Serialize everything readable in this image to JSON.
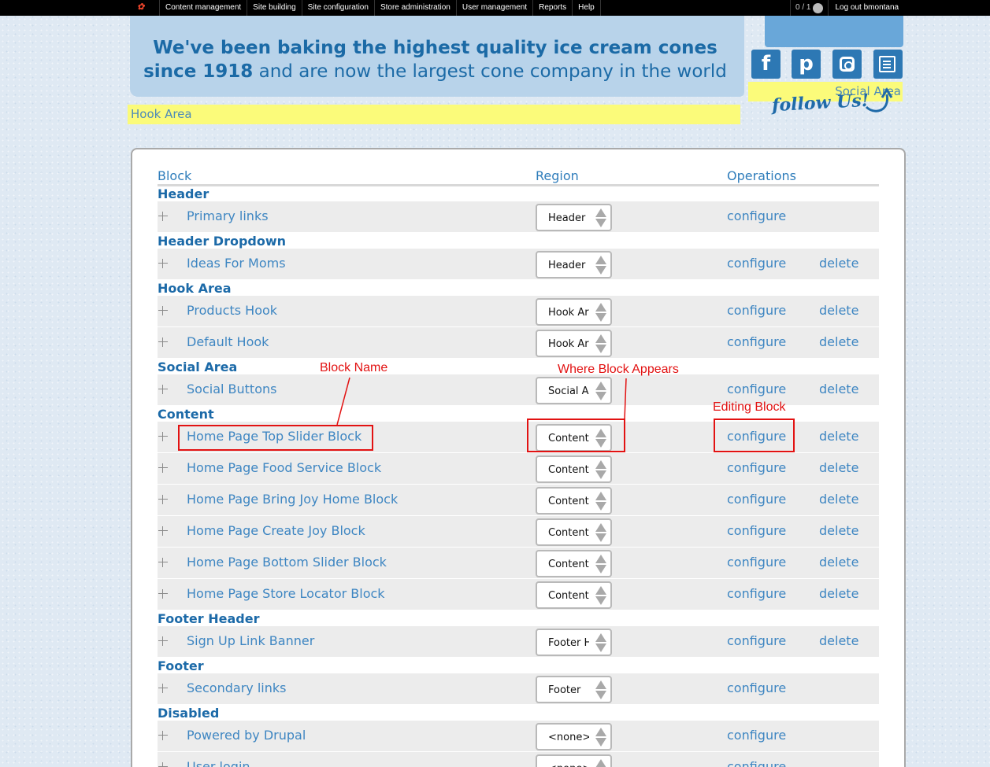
{
  "admin_bar": {
    "menu": [
      "Content management",
      "Site building",
      "Site configuration",
      "Store administration",
      "User management",
      "Reports",
      "Help"
    ],
    "counter": "0 / 1",
    "logout": "Log out bmontana"
  },
  "banner": {
    "line1": "We've been baking the highest quality ice cream cones",
    "line2_bold": "since 1918",
    "line2_rest": " and are now the largest cone company in the world"
  },
  "social": {
    "buttons": [
      {
        "icon": "facebook-icon",
        "glyph": "f"
      },
      {
        "icon": "pinterest-icon",
        "glyph": "p"
      },
      {
        "icon": "instagram-icon",
        "glyph": ""
      },
      {
        "icon": "edit-icon",
        "glyph": ""
      }
    ],
    "area_label": "Social Area",
    "follow_text": "follow Us!"
  },
  "hook_area_label": "Hook Area",
  "table": {
    "headers": {
      "block": "Block",
      "region": "Region",
      "operations": "Operations"
    },
    "configure_label": "configure",
    "delete_label": "delete",
    "groups": [
      {
        "region": "Header",
        "rows": [
          {
            "name": "Primary links",
            "region": "Header",
            "delete": false
          }
        ]
      },
      {
        "region": "Header Dropdown",
        "rows": [
          {
            "name": "Ideas For Moms",
            "region": "Header Dropdown",
            "delete": true
          }
        ]
      },
      {
        "region": "Hook Area",
        "rows": [
          {
            "name": "Products Hook",
            "region": "Hook Area",
            "delete": true
          },
          {
            "name": "Default Hook",
            "region": "Hook Area",
            "delete": true
          }
        ]
      },
      {
        "region": "Social Area",
        "rows": [
          {
            "name": "Social Buttons",
            "region": "Social Area",
            "delete": true
          }
        ]
      },
      {
        "region": "Content",
        "rows": [
          {
            "name": "Home Page Top Slider Block",
            "region": "Content",
            "delete": true
          },
          {
            "name": "Home Page Food Service Block",
            "region": "Content",
            "delete": true
          },
          {
            "name": "Home Page Bring Joy Home Block",
            "region": "Content",
            "delete": true
          },
          {
            "name": "Home Page Create Joy Block",
            "region": "Content",
            "delete": true
          },
          {
            "name": "Home Page Bottom Slider Block",
            "region": "Content",
            "delete": true
          },
          {
            "name": "Home Page Store Locator Block",
            "region": "Content",
            "delete": true
          }
        ]
      },
      {
        "region": "Footer Header",
        "rows": [
          {
            "name": "Sign Up Link Banner",
            "region": "Footer Header",
            "delete": true
          }
        ]
      },
      {
        "region": "Footer",
        "rows": [
          {
            "name": "Secondary links",
            "region": "Footer",
            "delete": false
          }
        ]
      },
      {
        "region": "Disabled",
        "rows": [
          {
            "name": "Powered by Drupal",
            "region": "<none>",
            "delete": false
          },
          {
            "name": "User login",
            "region": "<none>",
            "delete": false
          }
        ]
      }
    ]
  },
  "annotations": {
    "block_name": "Block Name",
    "where_block_appears": "Where Block Appears",
    "editing_block": "Editing Block",
    "color": "#e21212"
  },
  "colors": {
    "link": "#3e86c2",
    "region_heading": "#1c6aa8",
    "highlight": "#fbfb7a",
    "social_button": "#2d78b4"
  }
}
